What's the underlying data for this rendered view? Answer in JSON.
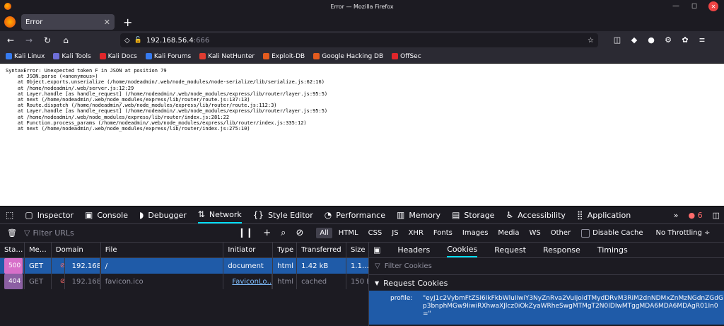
{
  "window": {
    "title": "Error — Mozilla Firefox"
  },
  "tab": {
    "title": "Error"
  },
  "url": {
    "host": "192.168.56.4",
    "port": ":666"
  },
  "bookmarks": [
    {
      "label": "Kali Linux",
      "color": "#367bf0"
    },
    {
      "label": "Kali Tools",
      "color": "#6f6fd8"
    },
    {
      "label": "Kali Docs",
      "color": "#e0262b"
    },
    {
      "label": "Kali Forums",
      "color": "#367bf0"
    },
    {
      "label": "Kali NetHunter",
      "color": "#e03c31"
    },
    {
      "label": "Exploit-DB",
      "color": "#e35b1e"
    },
    {
      "label": "Google Hacking DB",
      "color": "#e35b1e"
    },
    {
      "label": "OffSec",
      "color": "#e0262b"
    }
  ],
  "page": {
    "error_text": "SyntaxError: Unexpected token F in JSON at position 79\n    at JSON.parse (<anonymous>)\n    at Object.exports.unserialize (/home/nodeadmin/.web/node_modules/node-serialize/lib/serialize.js:62:16)\n    at /home/nodeadmin/.web/server.js:12:29\n    at Layer.handle [as handle_request] (/home/nodeadmin/.web/node_modules/express/lib/router/layer.js:95:5)\n    at next (/home/nodeadmin/.web/node_modules/express/lib/router/route.js:137:13)\n    at Route.dispatch (/home/nodeadmin/.web/node_modules/express/lib/router/route.js:112:3)\n    at Layer.handle [as handle_request] (/home/nodeadmin/.web/node_modules/express/lib/router/layer.js:95:5)\n    at /home/nodeadmin/.web/node_modules/express/lib/router/index.js:281:22\n    at Function.process_params (/home/nodeadmin/.web/node_modules/express/lib/router/index.js:335:12)\n    at next (/home/nodeadmin/.web/node_modules/express/lib/router/index.js:275:10)"
  },
  "devtools": {
    "tabs": [
      "Inspector",
      "Console",
      "Debugger",
      "Network",
      "Style Editor",
      "Performance",
      "Memory",
      "Storage",
      "Accessibility",
      "Application"
    ],
    "error_count": "6",
    "filter_placeholder": "Filter URLs",
    "types": [
      "All",
      "HTML",
      "CSS",
      "JS",
      "XHR",
      "Fonts",
      "Images",
      "Media",
      "WS",
      "Other"
    ],
    "disable_cache": "Disable Cache",
    "throttling": "No Throttling ÷",
    "columns": [
      "Sta…",
      "Me…",
      "Domain",
      "File",
      "Initiator",
      "Type",
      "Transferred",
      "Size"
    ],
    "rows": [
      {
        "status": "500",
        "method": "GET",
        "domain": "192.168…",
        "file": "/",
        "initiator": "document",
        "type": "html",
        "transferred": "1.42 kB",
        "size": "1.1…"
      },
      {
        "status": "404",
        "method": "GET",
        "domain": "192.168…",
        "file": "favicon.ico",
        "initiator": "FaviconLo…",
        "type": "html",
        "transferred": "cached",
        "size": "150 B"
      }
    ],
    "side_tabs": [
      "Headers",
      "Cookies",
      "Request",
      "Response",
      "Timings"
    ],
    "cookie_filter": "Filter Cookies",
    "request_cookies": "Request Cookies",
    "cookie_key": "profile:",
    "cookie_value": "\"eyJ1c2VybmFtZSI6IkFkbWluIiwiY3NyZnRva2VuIjoidTMydDRvM3RiM2dnNDMxZnMzNGdnZGdGp3bnphMGw9IiwiRXhwaXJlcz0iOkZyaWRheSwgMTMgT2N0IDIwMTggMDA6MDA6MDAgR01In0=\""
  }
}
